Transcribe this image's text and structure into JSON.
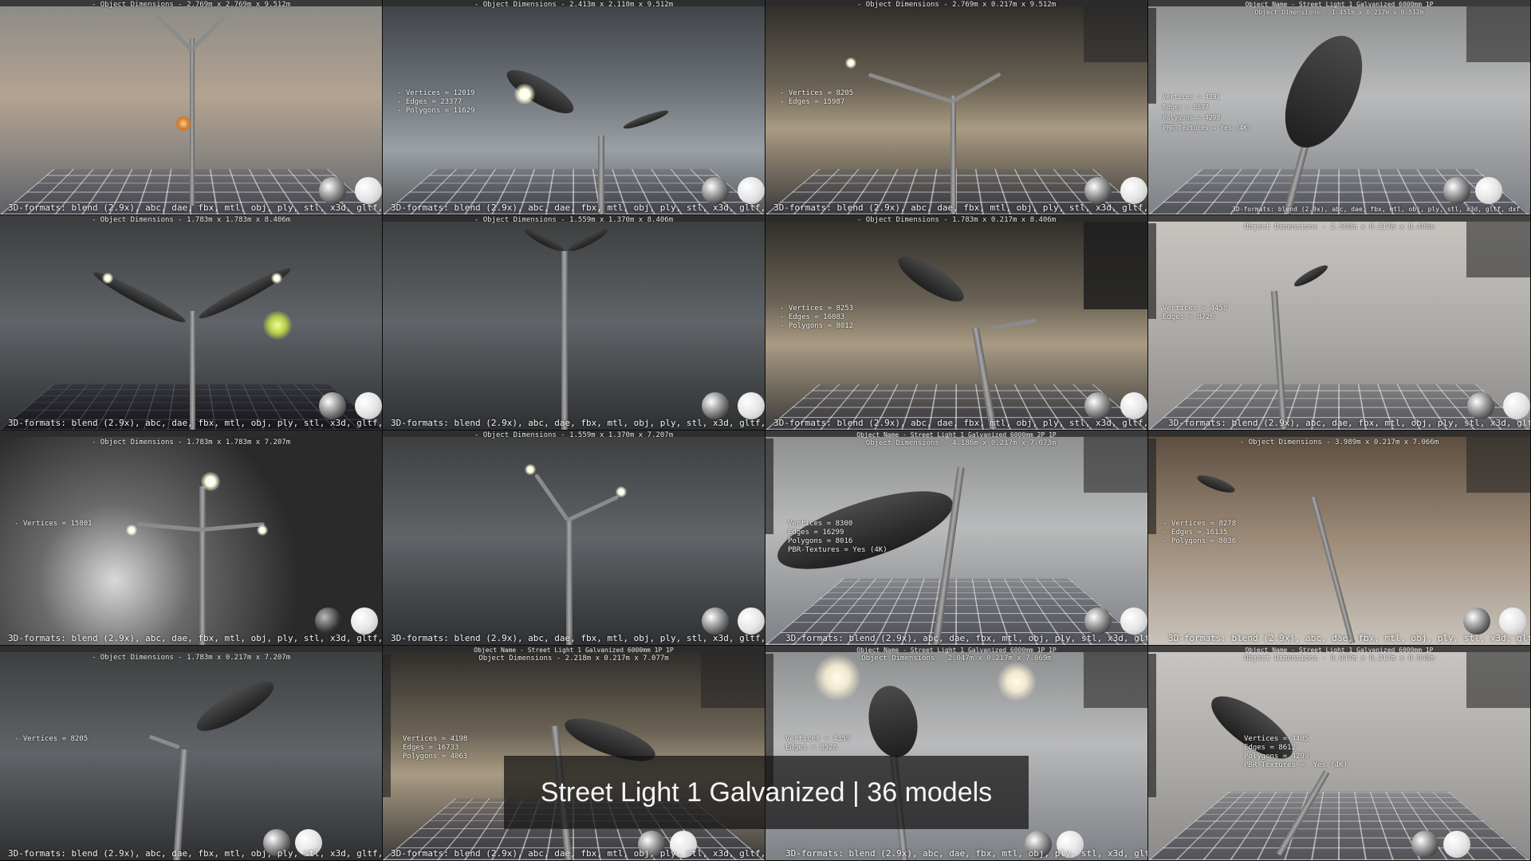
{
  "formats_label": "3D-formats: blend (2.9x), abc, dae, fbx, mtl, obj, ply, stl, x3d, gltf, dxf",
  "caption": "Street Light 1 Galvanized | 36 models",
  "tiles": [
    {
      "dims": "- Object Dimensions -  2.769m x 2.769m x 9.512m"
    },
    {
      "dims": "- Object Dimensions -  2.413m x 2.110m x 9.512m",
      "stats": "- Vertices = 12019\n- Edges = 23377\n- Polygons = 11629"
    },
    {
      "dims": "- Object Dimensions -  2.769m x 0.217m x 9.512m",
      "stats": "- Vertices = 8205\n- Edges = 15987"
    },
    {
      "objname": "Object Name - Street Light 1 Galvanized 6000mm 1P",
      "dims": "Object Dimensions - 1.451m x 0.217m x 9.512m",
      "stats": "Vertices = 4391\nEdges = 8597\nPolygons = 4298\nPBR-Textures = Yes (4K)"
    },
    {
      "dims": "- Object Dimensions -  1.783m x 1.783m x 8.406m"
    },
    {
      "dims": "- Object Dimensions -  1.559m x 1.370m x 8.406m"
    },
    {
      "dims": "- Object Dimensions -  1.783m x 0.217m x 8.406m",
      "stats": "- Vertices = 8253\n- Edges = 16083\n- Polygons = 8012"
    },
    {
      "dims": "Object Dimensions - 2.500m x 0.217m x 8.406m",
      "stats": "Vertices = 4458\nEdges = 8726"
    },
    {
      "dims": "- Object Dimensions -  1.783m x 1.783m x 7.207m",
      "stats": "- Vertices = 15801"
    },
    {
      "dims": "- Object Dimensions -  1.559m x 1.370m x 7.207m"
    },
    {
      "objname": "Object Name - Street Light 1 Galvanized 6000mm 2P 1P",
      "dims": "- Object Dimensions -  4.186m x 0.217m x 7.073m",
      "stats": "Vertices = 8300\nEdges = 16299\nPolygons = 8016\nPBR-Textures = Yes (4K)"
    },
    {
      "dims": "- Object Dimensions -  3.989m x 0.217m x 7.066m",
      "stats": "- Vertices = 8278\n- Edges = 16135\n- Polygons = 8036"
    },
    {
      "dims": "- Object Dimensions -  1.783m x 0.217m x 7.207m",
      "stats": "- Vertices = 8205"
    },
    {
      "objname": "Object Name - Street Light 1 Galvanized 6000mm 1P 1P",
      "dims": "Object Dimensions - 2.218m x 0.217m x 7.077m",
      "stats": "Vertices = 4198\nEdges = 16733\nPolygons = 4063"
    },
    {
      "objname": "Object Name - Street Light 1 Galvanized 6000mm 1P 1P",
      "dims": "Object Dimensions - 2.047m x 0.217m x 7.069m",
      "stats": "Vertices = 4359\nEdges = 8526"
    },
    {
      "objname": "Object Name - Street Light 1 Galvanized 6000mm 1P",
      "dims": "Object Dimensions - 0.947m x 0.217m x 0.948m",
      "stats": "Vertices = 4405\nEdges = 8612\nPolygons = 4299\nPBR-Textures =  Yes (4K)"
    }
  ]
}
